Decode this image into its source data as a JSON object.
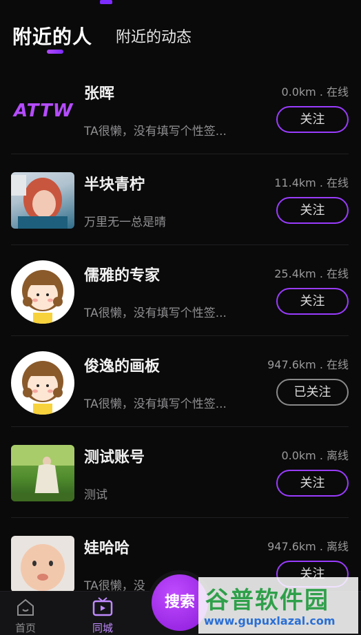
{
  "tabs": {
    "active": "附近的人",
    "inactive": "附近的动态"
  },
  "users": [
    {
      "name": "张晖",
      "signature": "TA很懒，没有填写个性签...",
      "distance": "0.0km . 在线",
      "button": "关注",
      "avatar": "attw-logo",
      "logo_text": "ATTW"
    },
    {
      "name": "半块青柠",
      "signature": "万里无一总是晴",
      "distance": "11.4km . 在线",
      "button": "关注",
      "avatar": "photo-woman"
    },
    {
      "name": "儒雅的专家",
      "signature": "TA很懒，没有填写个性签...",
      "distance": "25.4km . 在线",
      "button": "关注",
      "avatar": "cartoon-girl"
    },
    {
      "name": "俊逸的画板",
      "signature": "TA很懒，没有填写个性签...",
      "distance": "947.6km . 在线",
      "button": "已关注",
      "avatar": "cartoon-girl"
    },
    {
      "name": "测试账号",
      "signature": "测试",
      "distance": "0.0km . 离线",
      "button": "关注",
      "avatar": "photo-garden"
    },
    {
      "name": "娃哈哈",
      "signature": "TA很懒，没",
      "distance": "947.6km . 离线",
      "button": "关注",
      "avatar": "photo-baby"
    }
  ],
  "bottom_nav": {
    "home": "首页",
    "city": "同城",
    "search": "搜索"
  },
  "watermark": {
    "title": "谷普软件园",
    "url": "www.gupuxlazal.com"
  }
}
